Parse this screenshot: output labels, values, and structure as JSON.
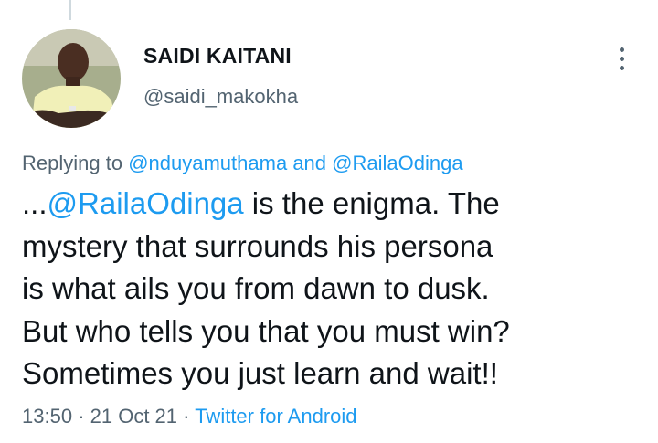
{
  "author": {
    "display_name": "SAIDI KAITANI",
    "handle": "@saidi_makokha",
    "avatar_icon": "profile-photo"
  },
  "more_icon": "more-options-icon",
  "reply": {
    "prefix": "Replying to",
    "user1": "@nduyamuthama",
    "conj": "and",
    "user2": "@RailaOdinga"
  },
  "tweet": {
    "lead": "...",
    "mention": "@RailaOdinga",
    "line1_rest": " is the enigma. The",
    "line2": "mystery that surrounds his persona",
    "line3": "is what ails you from dawn to dusk.",
    "line4": "But who tells you that you must win?",
    "line5": "Sometimes you just learn and wait!!"
  },
  "meta": {
    "time": "13:50",
    "sep1": "·",
    "date": "21 Oct 21",
    "sep2": "·",
    "source": "Twitter for Android"
  },
  "colors": {
    "link": "#1d9bf0",
    "secondary": "#536471",
    "text": "#0f1419"
  }
}
